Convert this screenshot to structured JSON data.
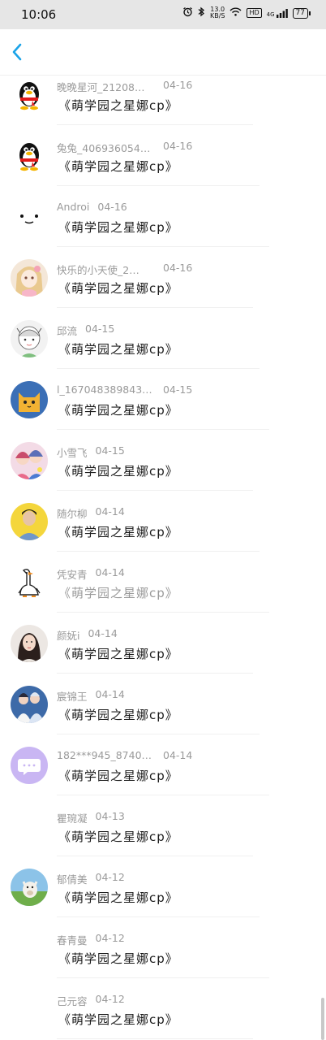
{
  "status": {
    "time": "10:06",
    "net_speed_value": "13.0",
    "net_speed_unit": "KB/S",
    "hd_badge": "HD",
    "signal_label": "4G",
    "battery": "77"
  },
  "rows": [
    {
      "name": "晚晚星河_21208…",
      "date": "04-16",
      "message": "《萌学园之星娜cp》",
      "avatar": "penguin",
      "faded": false
    },
    {
      "name": "兔兔_406936054…",
      "date": "04-16",
      "message": "《萌学园之星娜cp》",
      "avatar": "penguin",
      "faded": false
    },
    {
      "name": "Androi",
      "date": "04-16",
      "message": "《萌学园之星娜cp》",
      "avatar": "smiley",
      "faded": false
    },
    {
      "name": "快乐的小天使_2…",
      "date": "04-16",
      "message": "《萌学园之星娜cp》",
      "avatar": "anime-girl-pink",
      "faded": false
    },
    {
      "name": "邱流",
      "date": "04-15",
      "message": "《萌学园之星娜cp》",
      "avatar": "sketch-girl",
      "faded": false
    },
    {
      "name": "l_167048389843…",
      "date": "04-15",
      "message": "《萌学园之星娜cp》",
      "avatar": "yellow-cat",
      "faded": false
    },
    {
      "name": "小雪飞",
      "date": "04-15",
      "message": "《萌学园之星娜cp》",
      "avatar": "anime-group",
      "faded": false
    },
    {
      "name": "随尔柳",
      "date": "04-14",
      "message": "《萌学园之星娜cp》",
      "avatar": "boy-yellow",
      "faded": false
    },
    {
      "name": "凭安青",
      "date": "04-14",
      "message": "《萌学园之星娜cp》",
      "avatar": "goose",
      "faded": true
    },
    {
      "name": "颜妩i",
      "date": "04-14",
      "message": "《萌学园之星娜cp》",
      "avatar": "woman-portrait",
      "faded": false
    },
    {
      "name": "宸锦王",
      "date": "04-14",
      "message": "《萌学园之星娜cp》",
      "avatar": "couple-blue",
      "faded": false
    },
    {
      "name": "182***945_8740…",
      "date": "04-14",
      "message": "《萌学园之星娜cp》",
      "avatar": "chat-bubble",
      "faded": false
    },
    {
      "name": "瞿琬凝",
      "date": "04-13",
      "message": "《萌学园之星娜cp》",
      "avatar": "none",
      "faded": false
    },
    {
      "name": "郁倩美",
      "date": "04-12",
      "message": "《萌学园之星娜cp》",
      "avatar": "alpaca",
      "faded": false
    },
    {
      "name": "春青曼",
      "date": "04-12",
      "message": "《萌学园之星娜cp》",
      "avatar": "none",
      "faded": false
    },
    {
      "name": "己元容",
      "date": "04-12",
      "message": "《萌学园之星娜cp》",
      "avatar": "none",
      "faded": false
    }
  ]
}
